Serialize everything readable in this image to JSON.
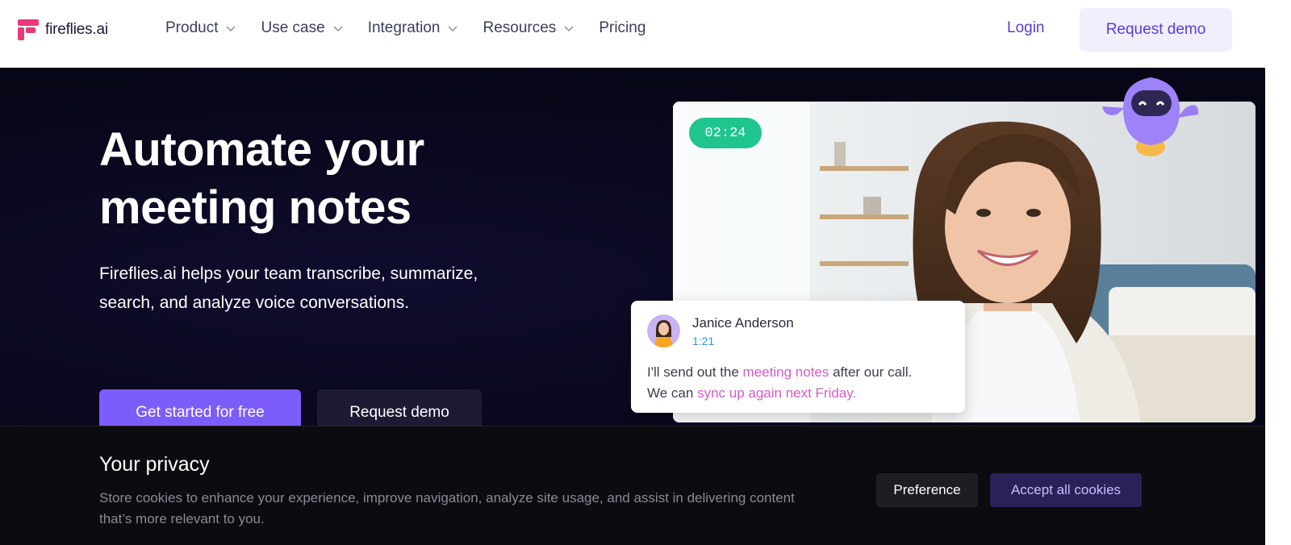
{
  "nav": {
    "logo_text": "fireflies.ai",
    "menu": [
      {
        "label": "Product",
        "has_dropdown": true
      },
      {
        "label": "Use case",
        "has_dropdown": true
      },
      {
        "label": "Integration",
        "has_dropdown": true
      },
      {
        "label": "Resources",
        "has_dropdown": true
      },
      {
        "label": "Pricing",
        "has_dropdown": false
      }
    ],
    "login_label": "Login",
    "request_demo_label": "Request demo"
  },
  "hero": {
    "headline_line1": "Automate your",
    "headline_line2": "meeting notes",
    "subtext_line1": "Fireflies.ai helps your team transcribe, summarize,",
    "subtext_line2": "search, and analyze voice conversations.",
    "cta_primary": "Get started for free",
    "cta_secondary": "Request demo"
  },
  "video": {
    "timer": "02:24",
    "transcript": {
      "speaker": "Janice Anderson",
      "timestamp": "1:21",
      "text_1": "I'll send out the ",
      "highlight_1": "meeting notes",
      "text_2": " after our call.",
      "text_3": "We can ",
      "highlight_2": "sync up again next Friday."
    }
  },
  "cookie": {
    "title": "Your privacy",
    "text": "Store cookies to enhance your experience, improve navigation, analyze site usage, and assist in delivering content that’s more relevant to you.",
    "preference_label": "Preference",
    "accept_label": "Accept all cookies"
  },
  "colors": {
    "brand": "#e8397c",
    "accent": "#7c5cfa",
    "link": "#5b3bd9",
    "timer": "#1fc48f",
    "highlight": "#d45cc7"
  }
}
